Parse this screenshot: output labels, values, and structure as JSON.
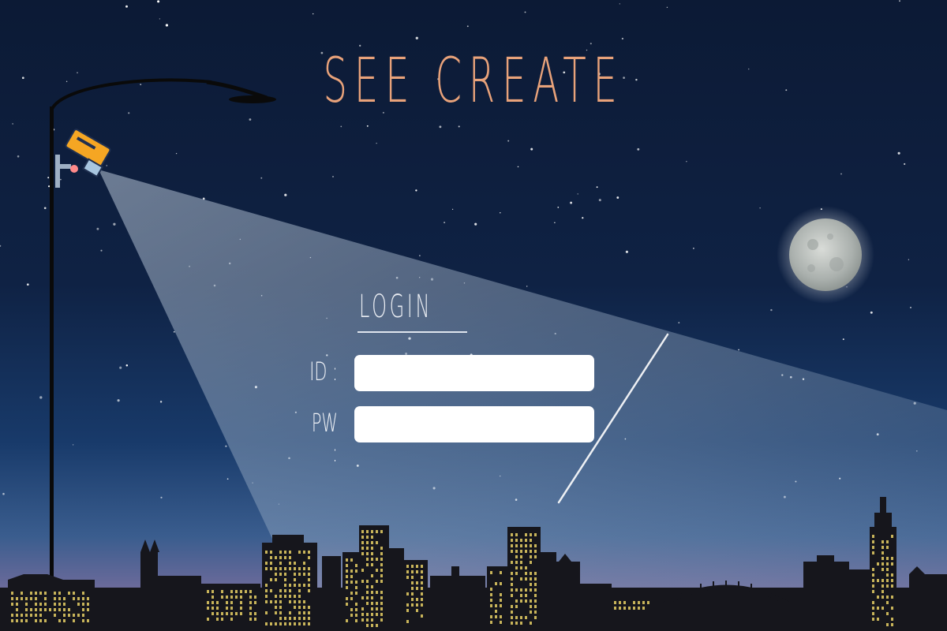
{
  "app": {
    "title": "SEE CREATE"
  },
  "login": {
    "heading": "LOGIN",
    "id_label": "ID :",
    "pw_label": "PW :",
    "id_value": "",
    "pw_value": ""
  },
  "scene": {
    "icons": [
      "street-lamp-icon",
      "security-camera-icon",
      "moon-icon",
      "shooting-star-icon",
      "city-skyline-icon",
      "bridge-icon"
    ],
    "colors": {
      "sky_top": "#0c1a35",
      "sky_bottom": "#8e6f99",
      "title": "#e8a27a",
      "camera": "#f5a623",
      "moon": "#c9ccc9",
      "window_light": "#c8b45a",
      "building": "#1a1a1f"
    }
  }
}
